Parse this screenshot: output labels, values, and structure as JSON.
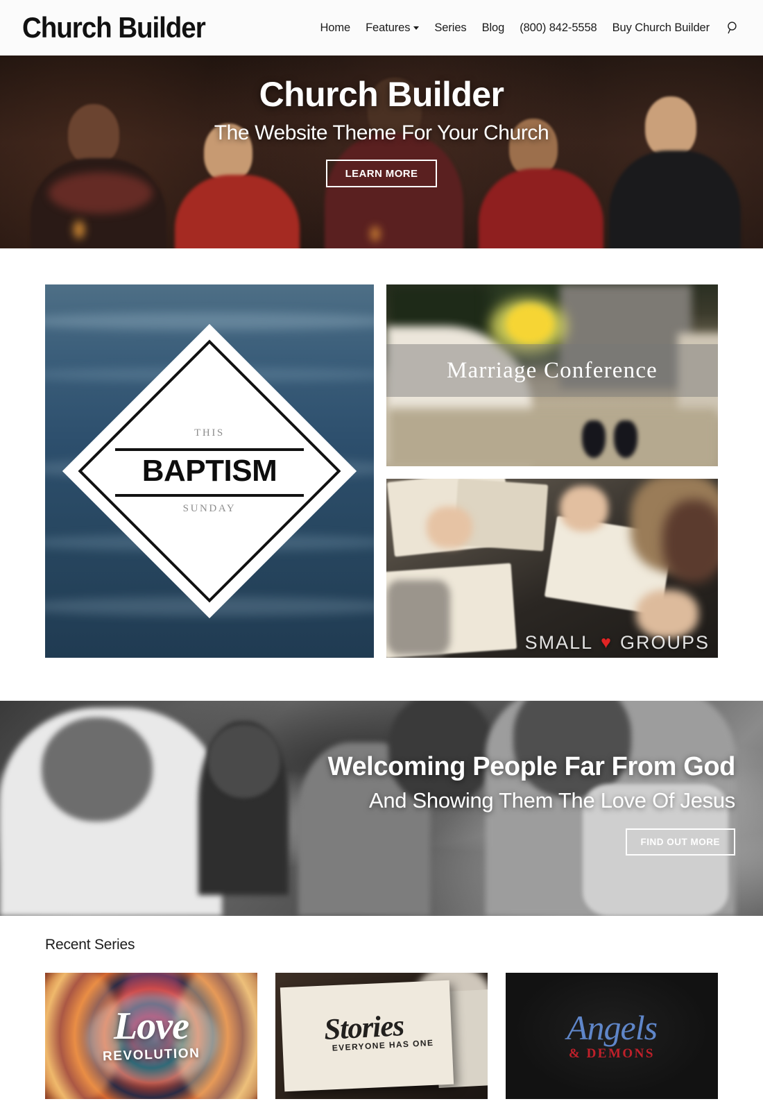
{
  "header": {
    "logo": "Church Builder",
    "nav": [
      {
        "label": "Home",
        "has_dropdown": false
      },
      {
        "label": "Features",
        "has_dropdown": true
      },
      {
        "label": "Series",
        "has_dropdown": false
      },
      {
        "label": "Blog",
        "has_dropdown": false
      },
      {
        "label": "(800) 842-5558",
        "has_dropdown": false
      },
      {
        "label": "Buy Church Builder",
        "has_dropdown": false
      }
    ],
    "search_icon": "search-icon"
  },
  "hero": {
    "title": "Church Builder",
    "subtitle": "The Website Theme For Your Church",
    "button": "LEARN MORE"
  },
  "features": {
    "baptism": {
      "top_word": "THIS",
      "main_word": "BAPTISM",
      "bottom_word": "SUNDAY"
    },
    "marriage": {
      "title": "Marriage Conference"
    },
    "small_groups": {
      "word_one": "SMALL",
      "heart": "♥",
      "word_two": "GROUPS"
    }
  },
  "welcome": {
    "title": "Welcoming People Far From God",
    "subtitle": "And Showing Them The Love Of Jesus",
    "button": "FIND OUT MORE"
  },
  "series": {
    "heading": "Recent Series",
    "items": [
      {
        "title": "Love",
        "subtitle": "REVOLUTION"
      },
      {
        "title": "Stories",
        "subtitle": "EVERYONE HAS ONE"
      },
      {
        "title": "Angels",
        "subtitle": "& DEMONS"
      }
    ]
  },
  "colors": {
    "header_bg": "#fbfbfb",
    "text": "#1b1b1b",
    "heart_red": "#e02424",
    "angels_blue": "#5f86c9",
    "demons_red": "#c0202a"
  }
}
